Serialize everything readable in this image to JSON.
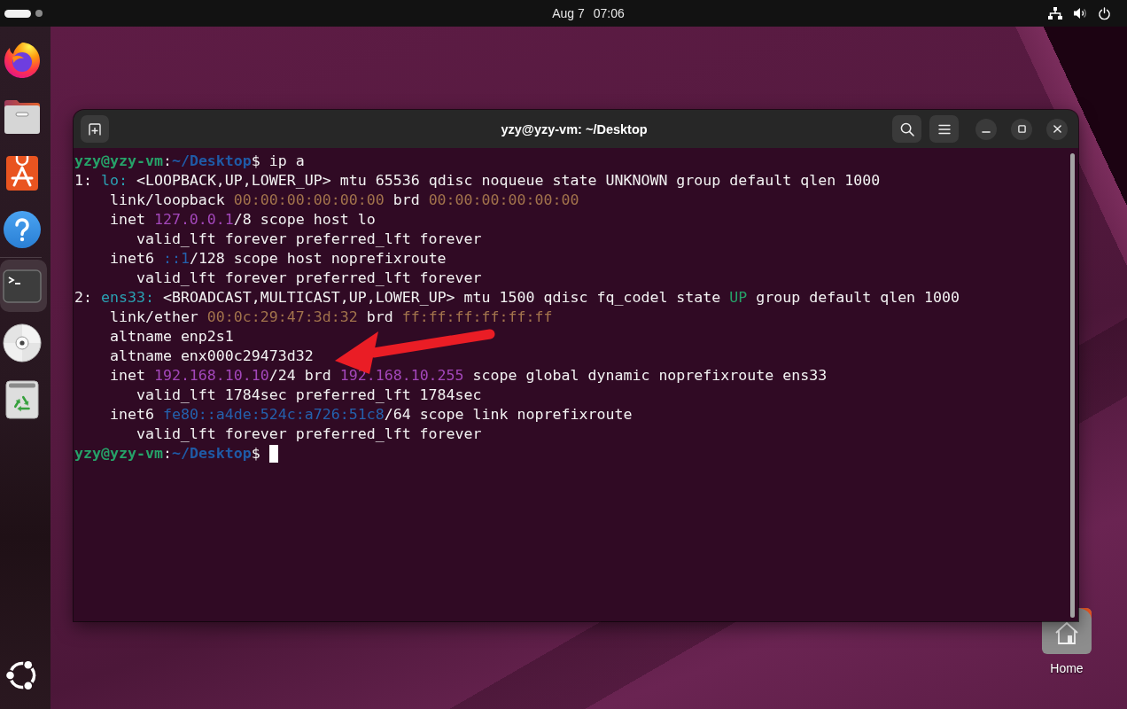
{
  "top_bar": {
    "workspaces": [
      {
        "selected": true
      },
      {
        "selected": false
      }
    ],
    "clock": {
      "date": "Aug 7",
      "time": "07:06"
    }
  },
  "dock": {
    "favorites": [
      {
        "selected": false
      },
      {
        "selected": false
      },
      {
        "selected": false
      },
      {
        "selected": false
      }
    ],
    "running": [
      {
        "selected": true
      },
      {
        "selected": false
      },
      {
        "selected": false
      }
    ]
  },
  "desktop_icons": [
    {
      "label": "Home"
    }
  ],
  "terminal": {
    "title": "yzy@yzy-vm: ~/Desktop",
    "command": {
      "segments": [
        {
          "text": "yzy@yzy-vm",
          "kind": "user"
        },
        {
          "text": ":",
          "kind": "plain"
        },
        {
          "text": "~/Desktop",
          "kind": "path"
        },
        {
          "text": "$ ip a",
          "kind": "plain"
        }
      ]
    },
    "output": [
      {
        "segments": [
          {
            "text": "1: ",
            "kind": "plain"
          },
          {
            "text": "lo:",
            "kind": "iface"
          },
          {
            "text": " <LOOPBACK,UP,LOWER_UP> mtu 65536 qdisc noqueue state UNKNOWN group default qlen 1000",
            "kind": "plain"
          }
        ],
        "children": [
          {
            "segments": [
              {
                "text": "link/loopback ",
                "kind": "plain"
              },
              {
                "text": "00:00:00:00:00:00",
                "kind": "mac"
              },
              {
                "text": " brd ",
                "kind": "plain"
              },
              {
                "text": "00:00:00:00:00:00",
                "kind": "mac"
              }
            ]
          },
          {
            "segments": [
              {
                "text": "inet ",
                "kind": "plain"
              },
              {
                "text": "127.0.0.1",
                "kind": "ipv4"
              },
              {
                "text": "/8 scope host lo",
                "kind": "plain"
              }
            ],
            "children": [
              {
                "segments": [
                  {
                    "text": "valid_lft forever preferred_lft forever",
                    "kind": "plain"
                  }
                ]
              }
            ]
          },
          {
            "segments": [
              {
                "text": "inet6 ",
                "kind": "plain"
              },
              {
                "text": "::1",
                "kind": "ipv6"
              },
              {
                "text": "/128 scope host noprefixroute",
                "kind": "plain"
              }
            ],
            "children": [
              {
                "segments": [
                  {
                    "text": "valid_lft forever preferred_lft forever",
                    "kind": "plain"
                  }
                ]
              }
            ]
          }
        ]
      },
      {
        "segments": [
          {
            "text": "2: ",
            "kind": "plain"
          },
          {
            "text": "ens33:",
            "kind": "iface"
          },
          {
            "text": " <BROADCAST,MULTICAST,UP,LOWER_UP> mtu 1500 qdisc fq_codel state ",
            "kind": "plain"
          },
          {
            "text": "UP",
            "kind": "state"
          },
          {
            "text": " group default qlen 1000",
            "kind": "plain"
          }
        ],
        "children": [
          {
            "segments": [
              {
                "text": "link/ether ",
                "kind": "plain"
              },
              {
                "text": "00:0c:29:47:3d:32",
                "kind": "mac"
              },
              {
                "text": " brd ",
                "kind": "plain"
              },
              {
                "text": "ff:ff:ff:ff:ff:ff",
                "kind": "mac"
              }
            ]
          },
          {
            "segments": [
              {
                "text": "altname enp2s1",
                "kind": "plain"
              }
            ]
          },
          {
            "segments": [
              {
                "text": "altname enx000c29473d32",
                "kind": "plain"
              }
            ]
          },
          {
            "segments": [
              {
                "text": "inet ",
                "kind": "plain"
              },
              {
                "text": "192.168.10.10",
                "kind": "ipv4"
              },
              {
                "text": "/24 brd ",
                "kind": "plain"
              },
              {
                "text": "192.168.10.255",
                "kind": "ipv4"
              },
              {
                "text": " scope global dynamic noprefixroute ens33",
                "kind": "plain"
              }
            ],
            "children": [
              {
                "segments": [
                  {
                    "text": "valid_lft 1784sec preferred_lft 1784sec",
                    "kind": "plain"
                  }
                ]
              }
            ]
          },
          {
            "segments": [
              {
                "text": "inet6 ",
                "kind": "plain"
              },
              {
                "text": "fe80::a4de:524c:a726:51c8",
                "kind": "ipv6"
              },
              {
                "text": "/64 scope link noprefixroute",
                "kind": "plain"
              }
            ],
            "children": [
              {
                "segments": [
                  {
                    "text": "valid_lft forever preferred_lft forever",
                    "kind": "plain"
                  }
                ]
              }
            ]
          }
        ]
      }
    ],
    "prompt": {
      "segments": [
        {
          "text": "yzy@yzy-vm",
          "kind": "user"
        },
        {
          "text": ":",
          "kind": "plain"
        },
        {
          "text": "~/Desktop",
          "kind": "path"
        },
        {
          "text": "$",
          "kind": "plain"
        }
      ],
      "cursor": true
    }
  }
}
